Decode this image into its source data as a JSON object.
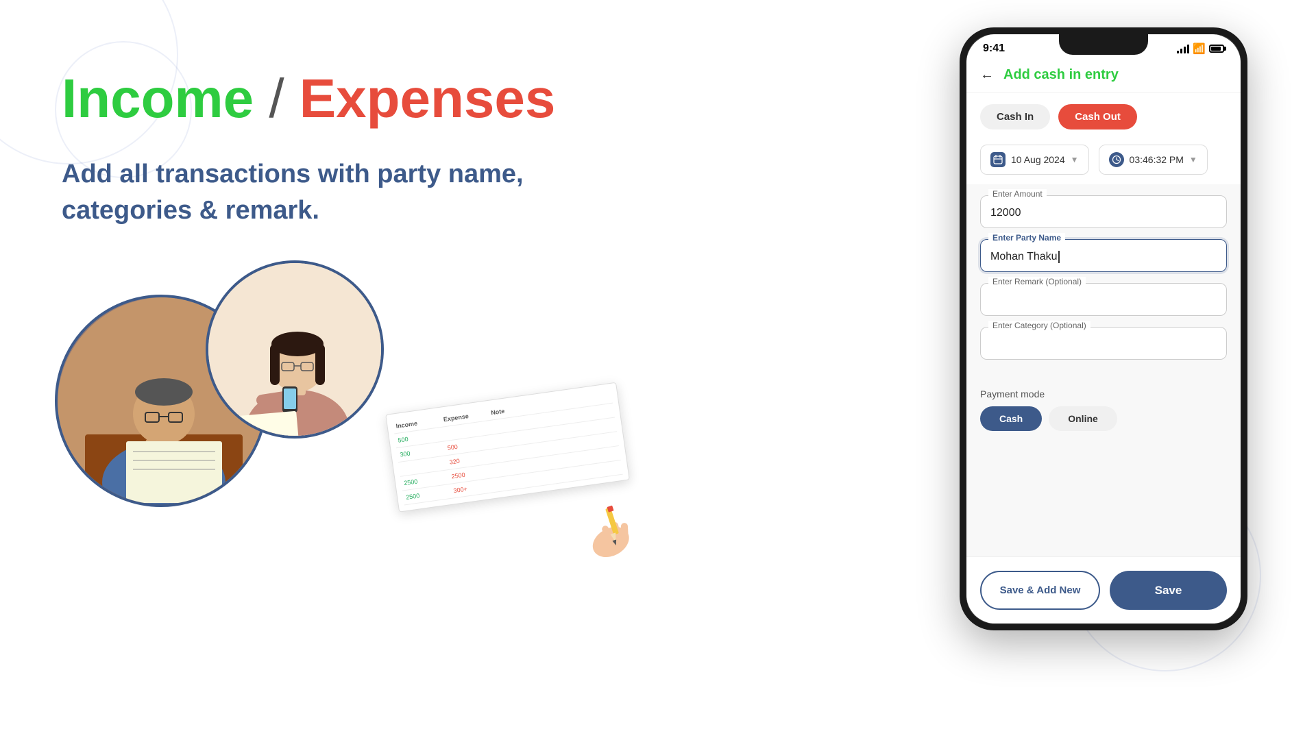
{
  "background": {
    "color": "#ffffff"
  },
  "left": {
    "headline": {
      "income": "Income",
      "slash": " / ",
      "expenses": "Expenses"
    },
    "subtext": "Add all transactions with party name, categories & remark."
  },
  "phone": {
    "statusBar": {
      "time": "9:41",
      "signalLabel": "signal",
      "wifiLabel": "wifi",
      "batteryLabel": "battery"
    },
    "header": {
      "backLabel": "←",
      "title": "Add cash in entry"
    },
    "tabs": {
      "cashIn": "Cash In",
      "cashOut": "Cash Out"
    },
    "datetime": {
      "date": "10 Aug 2024",
      "time": "03:46:32 PM"
    },
    "form": {
      "amountLabel": "Enter Amount",
      "amountValue": "12000",
      "partyLabel": "Enter Party Name",
      "partyValue": "Mohan Thaku",
      "remarkLabel": "Enter Remark (Optional)",
      "remarkValue": "",
      "categoryLabel": "Enter Category (Optional)",
      "categoryValue": ""
    },
    "payment": {
      "sectionLabel": "Payment mode",
      "cashLabel": "Cash",
      "onlineLabel": "Online"
    },
    "bottomButtons": {
      "saveAddNew": "Save & Add New",
      "save": "Save"
    }
  },
  "spreadsheet": {
    "headers": [
      "Income",
      "Expense",
      "Note"
    ],
    "rows": [
      [
        "500",
        "",
        ""
      ],
      [
        "300",
        "500",
        ""
      ],
      [
        "",
        "320",
        ""
      ],
      [
        "2500",
        "2500",
        ""
      ],
      [
        "2500",
        "300+",
        ""
      ]
    ]
  }
}
